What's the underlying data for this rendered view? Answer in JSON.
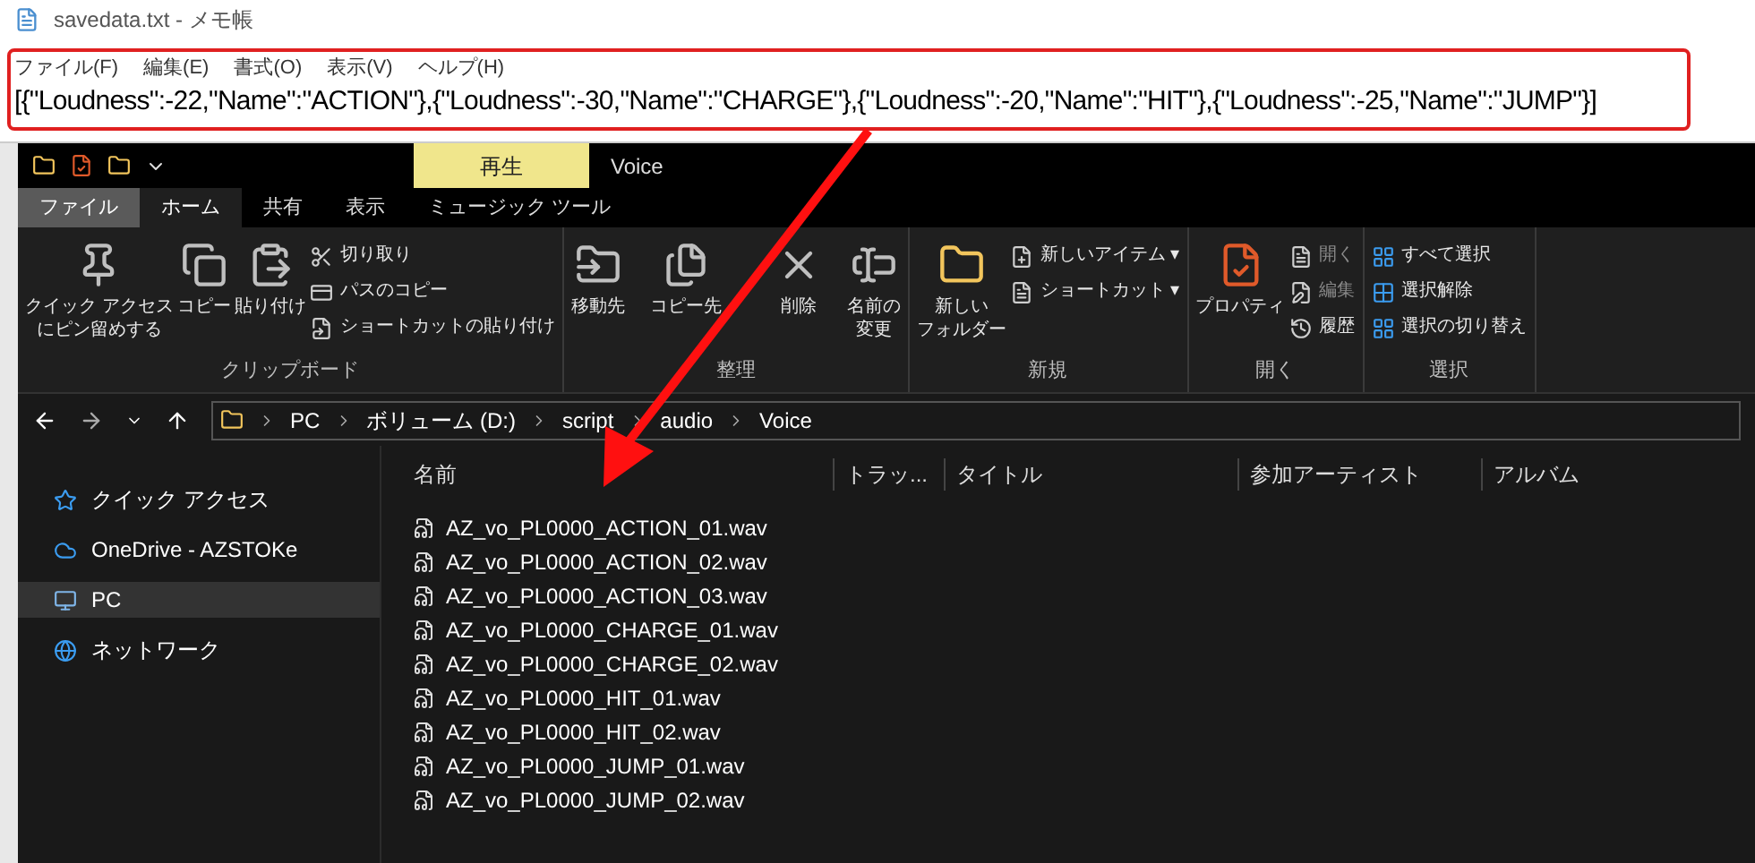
{
  "notepad": {
    "title": "savedata.txt - メモ帳",
    "menu": [
      "ファイル(F)",
      "編集(E)",
      "書式(O)",
      "表示(V)",
      "ヘルプ(H)"
    ],
    "content": "[{\"Loudness\":-22,\"Name\":\"ACTION\"},{\"Loudness\":-30,\"Name\":\"CHARGE\"},{\"Loudness\":-20,\"Name\":\"HIT\"},{\"Loudness\":-25,\"Name\":\"JUMP\"}]"
  },
  "explorer": {
    "context_tab": "再生",
    "title": "Voice",
    "tabs": [
      {
        "label": "ファイル",
        "selected": false,
        "kind": "file"
      },
      {
        "label": "ホーム",
        "selected": true,
        "kind": "tab"
      },
      {
        "label": "共有",
        "selected": false,
        "kind": "tab"
      },
      {
        "label": "表示",
        "selected": false,
        "kind": "tab"
      },
      {
        "label": "ミュージック ツール",
        "selected": false,
        "kind": "tab"
      }
    ],
    "ribbon": [
      {
        "label": "クリップボード",
        "items": [
          {
            "kind": "large",
            "lines": [
              "クイック アクセス",
              "にピン留めする"
            ]
          },
          {
            "kind": "large",
            "label": "コピー"
          },
          {
            "kind": "large",
            "label": "貼り付け"
          },
          {
            "kind": "small",
            "label": "切り取り",
            "disabled": false
          },
          {
            "kind": "small",
            "label": "パスのコピー",
            "disabled": false
          },
          {
            "kind": "small",
            "label": "ショートカットの貼り付け",
            "disabled": false
          }
        ]
      },
      {
        "label": "整理",
        "items": [
          {
            "kind": "large",
            "label": "移動先"
          },
          {
            "kind": "large",
            "label": "コピー先"
          },
          {
            "kind": "large",
            "label": "削除"
          },
          {
            "kind": "large",
            "lines": [
              "名前の",
              "変更"
            ]
          }
        ]
      },
      {
        "label": "新規",
        "items": [
          {
            "kind": "large",
            "lines": [
              "新しい",
              "フォルダー"
            ]
          },
          {
            "kind": "small",
            "label": "新しいアイテム ▾",
            "disabled": false
          },
          {
            "kind": "small",
            "label": "ショートカット ▾",
            "disabled": false
          }
        ]
      },
      {
        "label": "開く",
        "items": [
          {
            "kind": "large",
            "label": "プロパティ"
          },
          {
            "kind": "small",
            "label": "開く",
            "disabled": true
          },
          {
            "kind": "small",
            "label": "編集",
            "disabled": true
          },
          {
            "kind": "small",
            "label": "履歴",
            "disabled": false
          }
        ]
      },
      {
        "label": "選択",
        "items": [
          {
            "kind": "small",
            "label": "すべて選択",
            "disabled": false
          },
          {
            "kind": "small",
            "label": "選択解除",
            "disabled": false
          },
          {
            "kind": "small",
            "label": "選択の切り替え",
            "disabled": false
          }
        ]
      }
    ],
    "breadcrumb": [
      "PC",
      "ボリューム (D:)",
      "script",
      "audio",
      "Voice"
    ],
    "nav": [
      {
        "label": "クイック アクセス",
        "selected": false
      },
      {
        "label": "OneDrive - AZSTOKe",
        "selected": false
      },
      {
        "label": "PC",
        "selected": true
      },
      {
        "label": "ネットワーク",
        "selected": false
      }
    ],
    "columns": [
      "名前",
      "トラッ...",
      "タイトル",
      "参加アーティスト",
      "アルバム"
    ],
    "files": [
      "AZ_vo_PL0000_ACTION_01.wav",
      "AZ_vo_PL0000_ACTION_02.wav",
      "AZ_vo_PL0000_ACTION_03.wav",
      "AZ_vo_PL0000_CHARGE_01.wav",
      "AZ_vo_PL0000_CHARGE_02.wav",
      "AZ_vo_PL0000_HIT_01.wav",
      "AZ_vo_PL0000_HIT_02.wav",
      "AZ_vo_PL0000_JUMP_01.wav",
      "AZ_vo_PL0000_JUMP_02.wav"
    ]
  }
}
